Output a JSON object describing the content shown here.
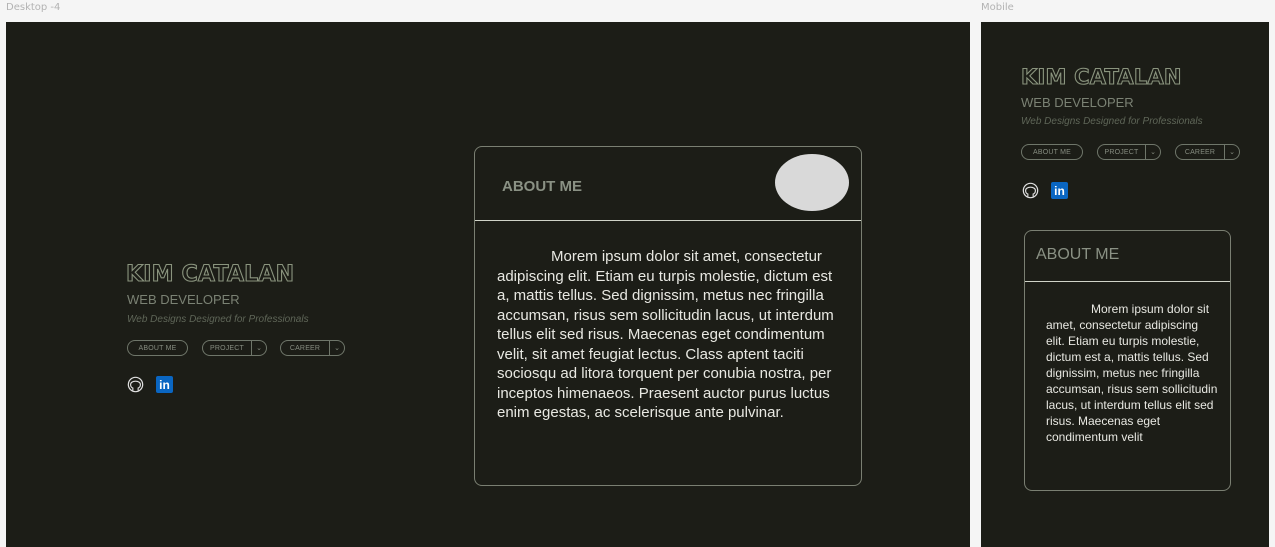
{
  "frames": {
    "desktop_label": "Desktop -4",
    "mobile_label": "Mobile"
  },
  "profile": {
    "name": "KIM CATALAN",
    "role": "WEB DEVELOPER",
    "tagline": "Web Designs Designed for Professionals"
  },
  "nav": {
    "about": "ABOUT ME",
    "project": "PROJECT",
    "career": "CAREER",
    "caret": "⌄"
  },
  "social": {
    "github_icon": "github-icon",
    "linkedin_icon": "linkedin-icon",
    "linkedin_text": "in"
  },
  "about": {
    "title": "ABOUT ME",
    "desktop_body": "Morem ipsum dolor sit amet, consectetur adipiscing elit. Etiam eu turpis molestie, dictum est a, mattis tellus. Sed dignissim, metus nec fringilla accumsan, risus sem sollicitudin lacus, ut interdum tellus elit sed risus. Maecenas eget condimentum velit, sit amet feugiat lectus. Class aptent taciti sociosqu ad litora torquent per conubia nostra, per inceptos himenaeos. Praesent auctor purus luctus enim egestas, ac scelerisque ante pulvinar.",
    "mobile_body": "Morem ipsum dolor sit amet, consectetur adipiscing elit. Etiam eu turpis molestie, dictum est a, mattis tellus. Sed dignissim, metus nec fringilla accumsan, risus sem sollicitudin lacus, ut interdum tellus elit sed risus. Maecenas eget condimentum velit"
  },
  "colors": {
    "background": "#1c1d17",
    "accent": "#8a947e",
    "linkedin": "#0a66c2"
  }
}
